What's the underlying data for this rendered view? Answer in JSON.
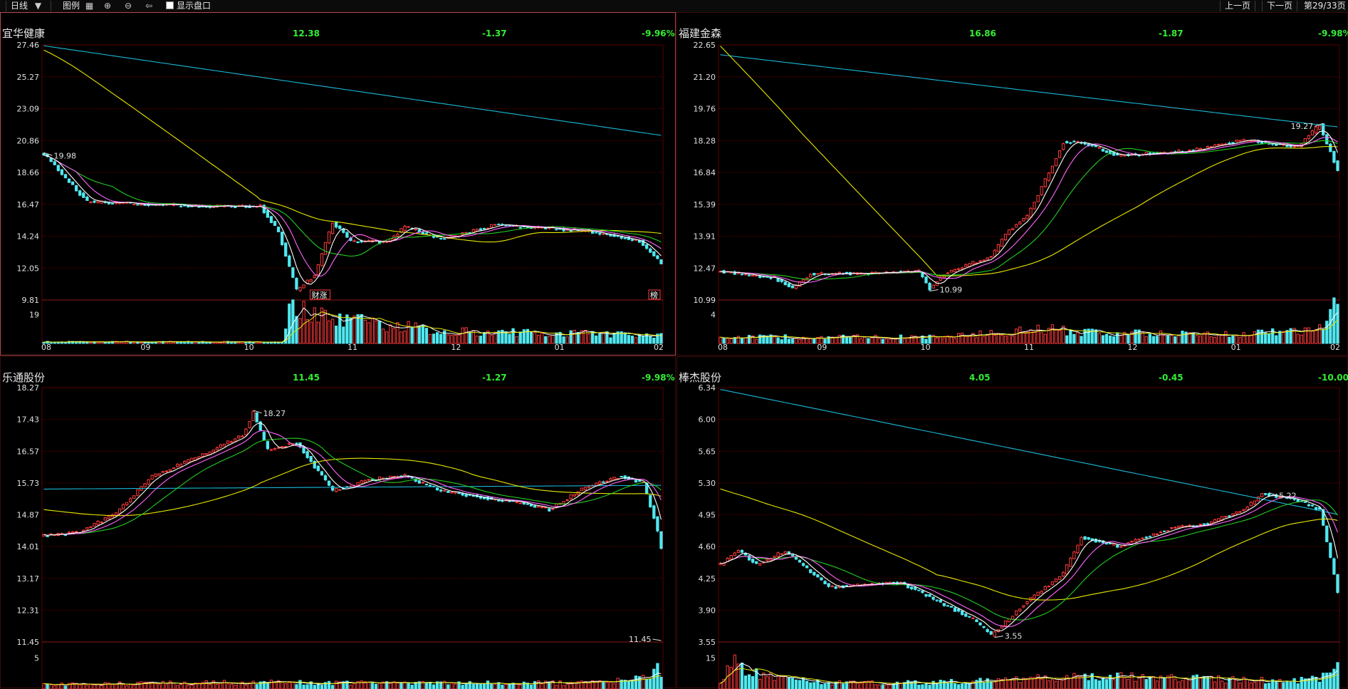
{
  "toolbar": {
    "period": "日线",
    "legend": "图例",
    "show_plate": "显示盘口",
    "prev_page": "上一页",
    "next_page": "下一页",
    "page_info": "第29/33页"
  },
  "colors": {
    "up": "#ff3b3b",
    "down": "#50e8f0",
    "ma5": "#ffffff",
    "ma10": "#ff66ff",
    "ma20": "#22cc22",
    "ma60": "#e8e800",
    "ma120": "#1ab8d6",
    "grid": "#5a0000",
    "axis_text": "#e0e0e0",
    "change": "#33ee33"
  },
  "chart_data": [
    {
      "type": "candlestick",
      "name": "宜华健康",
      "price": "12.38",
      "change": "-1.37",
      "pct": "-9.96%",
      "price_ticks": [
        "27.46",
        "25.27",
        "23.09",
        "20.86",
        "18.66",
        "16.47",
        "14.24",
        "12.05",
        "9.81"
      ],
      "ylim": [
        9.81,
        27.46
      ],
      "vol_tick": "19",
      "vol_ylim": [
        0,
        26
      ],
      "x_labels": [
        "08",
        "09",
        "10",
        "11",
        "12",
        "01",
        "02"
      ],
      "annotations": [
        {
          "label": "19.98"
        },
        {
          "label": "财涨",
          "tag": true,
          "color": "#ff3b3b"
        },
        {
          "label": "榜",
          "tag": true,
          "color": "#ff3b3b"
        }
      ],
      "gen": {
        "seed": 3,
        "anchors": [
          [
            0,
            19.9
          ],
          [
            12,
            16.6
          ],
          [
            45,
            16.3
          ],
          [
            60,
            16.3
          ],
          [
            65,
            14.5
          ],
          [
            70,
            10.5
          ],
          [
            75,
            11.5
          ],
          [
            80,
            15.2
          ],
          [
            85,
            13.9
          ],
          [
            95,
            13.8
          ],
          [
            100,
            14.9
          ],
          [
            110,
            14.0
          ],
          [
            125,
            15.0
          ],
          [
            150,
            14.6
          ],
          [
            165,
            13.9
          ],
          [
            171,
            12.4
          ]
        ],
        "vol_anchors": [
          [
            0,
            1
          ],
          [
            66,
            1
          ],
          [
            68,
            19
          ],
          [
            71,
            22
          ],
          [
            80,
            15
          ],
          [
            95,
            12
          ],
          [
            110,
            8
          ],
          [
            130,
            7
          ],
          [
            171,
            5
          ]
        ],
        "vol": 2.2,
        "ma60_start": 27.1,
        "ma120_start": 27.4,
        "ma120_end": 21.2
      }
    },
    {
      "type": "candlestick",
      "name": "福建金森",
      "price": "16.86",
      "change": "-1.87",
      "pct": "-9.98%",
      "price_ticks": [
        "22.65",
        "21.20",
        "19.76",
        "18.28",
        "16.84",
        "15.39",
        "13.91",
        "12.47",
        "10.99"
      ],
      "ylim": [
        10.99,
        22.65
      ],
      "vol_tick": "4",
      "vol_ylim": [
        0,
        6.5
      ],
      "x_labels": [
        "08",
        "09",
        "10",
        "11",
        "12",
        "01",
        "02"
      ],
      "annotations": [
        {
          "label": "10.99"
        },
        {
          "label": "19.27"
        }
      ],
      "gen": {
        "seed": 7,
        "anchors": [
          [
            0,
            12.3
          ],
          [
            15,
            12.0
          ],
          [
            20,
            11.5
          ],
          [
            25,
            12.2
          ],
          [
            40,
            12.2
          ],
          [
            55,
            12.3
          ],
          [
            58,
            11.5
          ],
          [
            62,
            12.2
          ],
          [
            75,
            13.0
          ],
          [
            80,
            14.2
          ],
          [
            85,
            14.8
          ],
          [
            95,
            18.2
          ],
          [
            100,
            18.2
          ],
          [
            110,
            17.6
          ],
          [
            130,
            17.8
          ],
          [
            145,
            18.3
          ],
          [
            160,
            18.0
          ],
          [
            166,
            19.0
          ],
          [
            171,
            16.9
          ]
        ],
        "vol_anchors": [
          [
            0,
            1
          ],
          [
            60,
            1
          ],
          [
            70,
            1.4
          ],
          [
            90,
            2.2
          ],
          [
            110,
            1.6
          ],
          [
            140,
            1.4
          ],
          [
            165,
            2
          ],
          [
            170,
            5.5
          ],
          [
            171,
            4.5
          ]
        ],
        "vol": 0.6,
        "ma60_start": 22.6,
        "ma120_start": 22.2,
        "ma120_end": 18.9
      }
    },
    {
      "type": "candlestick",
      "name": "乐通股份",
      "price": "11.45",
      "change": "-1.27",
      "pct": "-9.98%",
      "price_ticks": [
        "18.27",
        "17.43",
        "16.57",
        "15.73",
        "14.87",
        "14.01",
        "13.17",
        "12.31",
        "11.45"
      ],
      "ylim": [
        11.45,
        18.27
      ],
      "vol_tick": "5",
      "vol_ylim": [
        0,
        8
      ],
      "x_labels": [],
      "annotations": [
        {
          "label": "18.27"
        },
        {
          "label": "11.45"
        }
      ],
      "gen": {
        "seed": 11,
        "anchors": [
          [
            0,
            14.3
          ],
          [
            10,
            14.4
          ],
          [
            20,
            14.9
          ],
          [
            30,
            15.9
          ],
          [
            45,
            16.5
          ],
          [
            55,
            17.0
          ],
          [
            58,
            17.6
          ],
          [
            62,
            16.6
          ],
          [
            70,
            16.8
          ],
          [
            80,
            15.5
          ],
          [
            90,
            15.8
          ],
          [
            100,
            15.9
          ],
          [
            110,
            15.5
          ],
          [
            130,
            15.2
          ],
          [
            140,
            15.0
          ],
          [
            150,
            15.6
          ],
          [
            160,
            15.9
          ],
          [
            166,
            15.7
          ],
          [
            169,
            14.8
          ],
          [
            171,
            14.0
          ]
        ],
        "vol_anchors": [
          [
            0,
            0.8
          ],
          [
            60,
            1.2
          ],
          [
            100,
            1
          ],
          [
            150,
            1.1
          ],
          [
            168,
            2
          ],
          [
            170,
            7
          ],
          [
            171,
            3
          ]
        ],
        "vol": 0.3,
        "ma60_start": 15.0,
        "ma120_start": 15.55,
        "ma120_end": 15.65
      }
    },
    {
      "type": "candlestick",
      "name": "棒杰股份",
      "price": "4.05",
      "change": "-0.45",
      "pct": "-10.00%",
      "price_ticks": [
        "6.34",
        "6.00",
        "5.65",
        "5.30",
        "4.95",
        "4.60",
        "4.25",
        "3.90",
        "3.55"
      ],
      "ylim": [
        3.55,
        6.34
      ],
      "vol_tick": "15",
      "vol_ylim": [
        0,
        28
      ],
      "x_labels": [],
      "annotations": [
        {
          "label": "3.55"
        },
        {
          "label": "5.22"
        }
      ],
      "gen": {
        "seed": 5,
        "anchors": [
          [
            0,
            4.4
          ],
          [
            5,
            4.55
          ],
          [
            10,
            4.4
          ],
          [
            18,
            4.55
          ],
          [
            30,
            4.15
          ],
          [
            50,
            4.2
          ],
          [
            60,
            4.0
          ],
          [
            70,
            3.8
          ],
          [
            75,
            3.62
          ],
          [
            85,
            4.0
          ],
          [
            95,
            4.3
          ],
          [
            100,
            4.7
          ],
          [
            110,
            4.6
          ],
          [
            125,
            4.8
          ],
          [
            135,
            4.85
          ],
          [
            145,
            5.0
          ],
          [
            150,
            5.18
          ],
          [
            160,
            5.1
          ],
          [
            166,
            5.0
          ],
          [
            171,
            4.1
          ]
        ],
        "vol_anchors": [
          [
            0,
            4
          ],
          [
            3,
            18
          ],
          [
            8,
            10
          ],
          [
            30,
            4
          ],
          [
            60,
            4
          ],
          [
            80,
            6
          ],
          [
            110,
            8
          ],
          [
            140,
            6
          ],
          [
            160,
            5
          ],
          [
            168,
            8
          ],
          [
            171,
            18
          ]
        ],
        "vol": 0.11,
        "ma60_start": 5.23,
        "ma120_start": 6.32,
        "ma120_end": 4.95
      }
    }
  ]
}
